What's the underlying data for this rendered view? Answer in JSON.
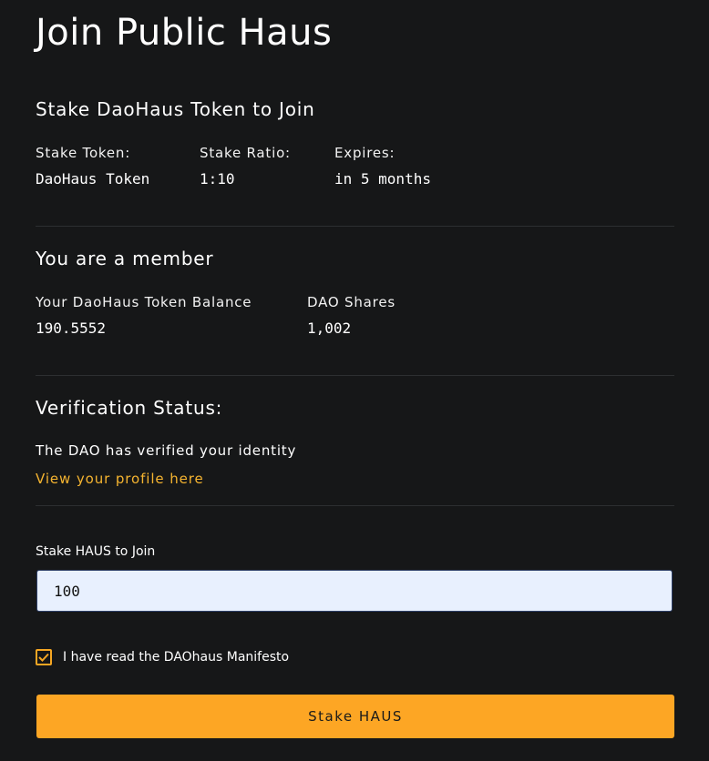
{
  "page": {
    "title": "Join Public Haus"
  },
  "stake_section": {
    "title": "Stake DaoHaus Token to Join",
    "fields": [
      {
        "label": "Stake Token:",
        "value": "DaoHaus Token"
      },
      {
        "label": "Stake Ratio:",
        "value": "1:10"
      },
      {
        "label": "Expires:",
        "value": "in 5 months"
      }
    ]
  },
  "member_section": {
    "title": "You are a member",
    "fields": [
      {
        "label": "Your DaoHaus Token Balance",
        "value": "190.5552"
      },
      {
        "label": "DAO Shares",
        "value": "1,002"
      }
    ]
  },
  "verification_section": {
    "title": "Verification Status:",
    "message": "The DAO has verified your identity",
    "link_label": "View your profile here"
  },
  "stake_form": {
    "input_label": "Stake HAUS to Join",
    "input_value": "100",
    "checkbox_label": "I have read the DAOhaus Manifesto",
    "checkbox_checked": true,
    "button_label": "Stake HAUS"
  },
  "colors": {
    "background": "#161718",
    "accent": "#fda624",
    "link": "#f5b430",
    "input_background": "#e8f0fe",
    "divider": "#2d2f31"
  },
  "icons": {
    "checkbox": "check-icon"
  }
}
